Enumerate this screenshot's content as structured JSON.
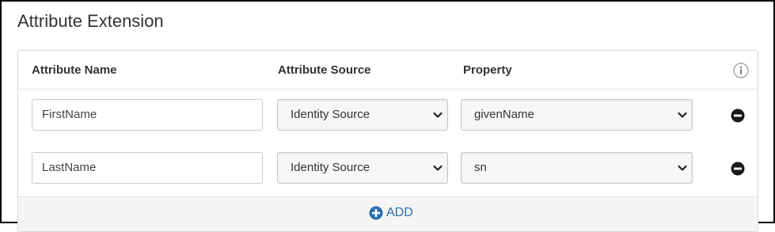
{
  "section": {
    "title": "Attribute Extension"
  },
  "table": {
    "headers": {
      "attribute_name": "Attribute Name",
      "attribute_source": "Attribute Source",
      "property": "Property"
    },
    "rows": [
      {
        "attribute_name": "FirstName",
        "attribute_source": "Identity Source",
        "property": "givenName"
      },
      {
        "attribute_name": "LastName",
        "attribute_source": "Identity Source",
        "property": "sn"
      }
    ]
  },
  "footer": {
    "add_label": "ADD"
  },
  "icons": {
    "info": "info-icon",
    "remove": "minus-circle-icon",
    "add": "plus-circle-icon",
    "dropdown": "chevron-down-icon"
  },
  "colors": {
    "accent": "#2b6cb0",
    "remove": "#1a1a1a",
    "border": "#d9d9d9"
  }
}
